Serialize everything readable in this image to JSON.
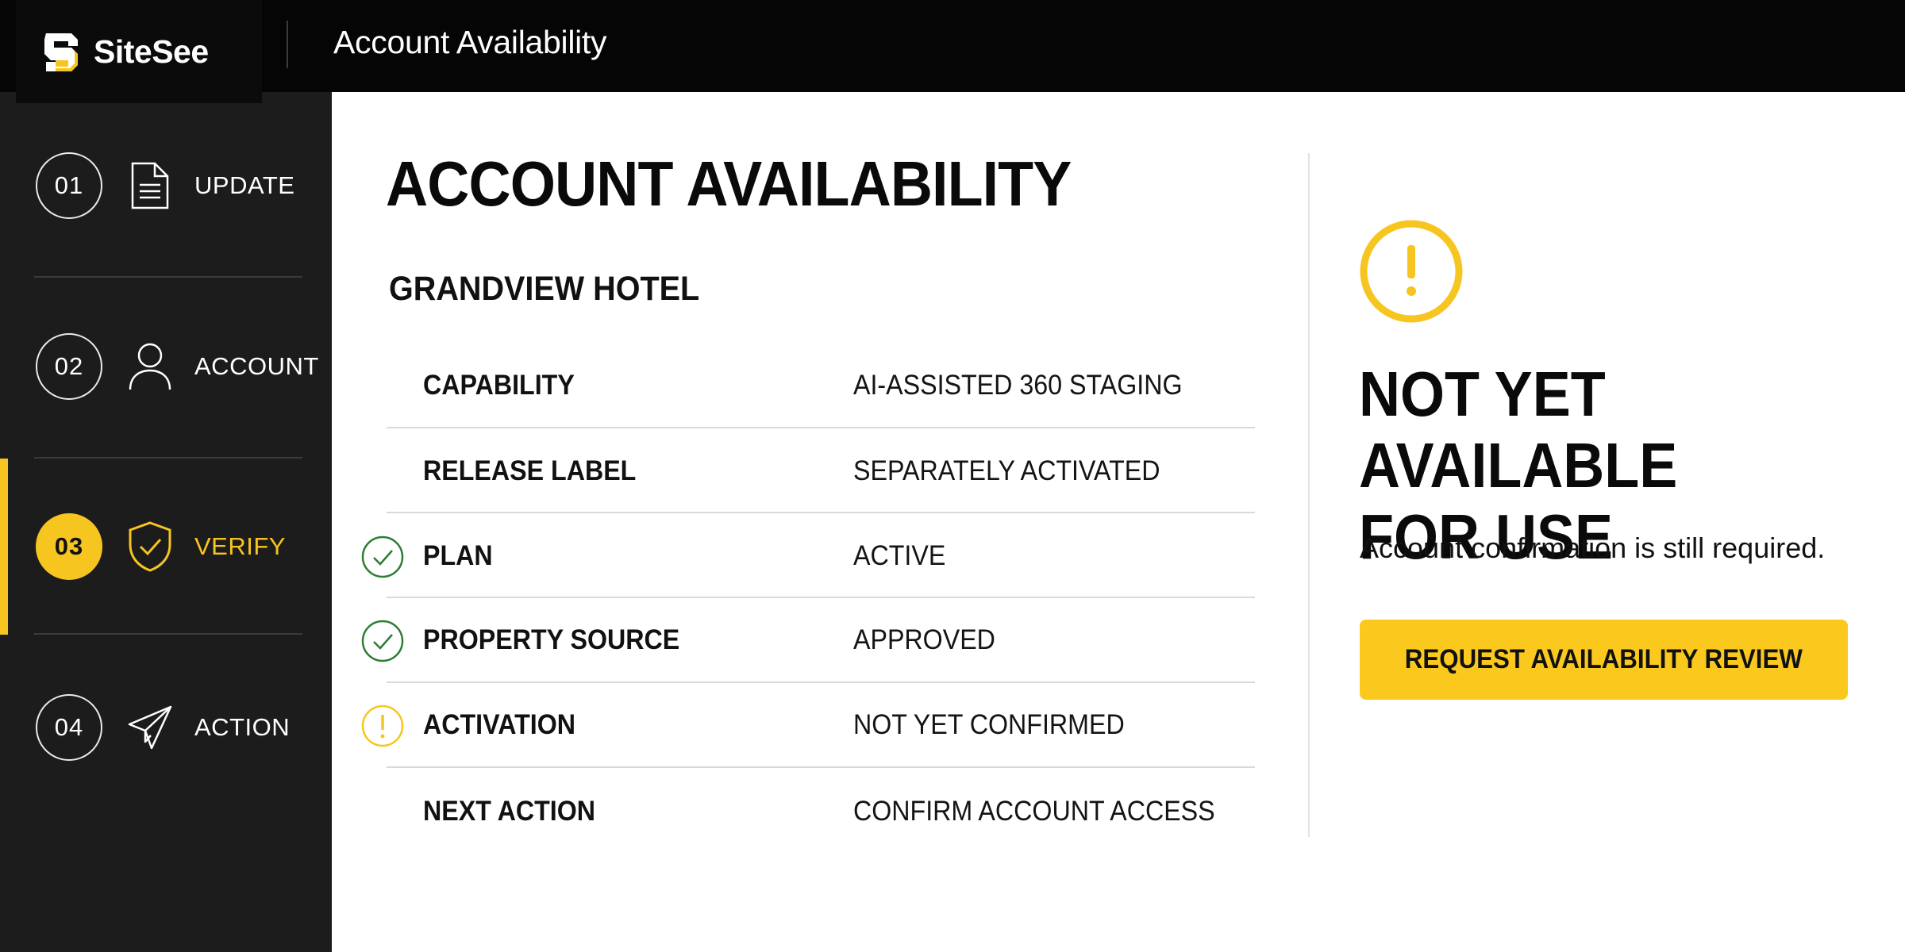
{
  "app": {
    "brand_name": "SiteSee",
    "window_title": "Account Availability"
  },
  "colors": {
    "accent": "#f7c520",
    "sidebar_bg": "#1c1c1c",
    "topbar_bg": "#050505",
    "check_green": "#2e7d32"
  },
  "sidebar": {
    "steps": [
      {
        "number": "01",
        "label": "UPDATE",
        "icon": "document-icon",
        "active": false
      },
      {
        "number": "02",
        "label": "ACCOUNT",
        "icon": "user-icon",
        "active": false
      },
      {
        "number": "03",
        "label": "VERIFY",
        "icon": "shield-check-icon",
        "active": true
      },
      {
        "number": "04",
        "label": "ACTION",
        "icon": "paper-plane-icon",
        "active": false
      }
    ]
  },
  "main": {
    "title": "ACCOUNT AVAILABILITY",
    "property_name": "GRANDVIEW HOTEL",
    "rows": [
      {
        "label": "CAPABILITY",
        "value": "AI-ASSISTED 360 STAGING",
        "status": "none"
      },
      {
        "label": "RELEASE LABEL",
        "value": "SEPARATELY ACTIVATED",
        "status": "none"
      },
      {
        "label": "PLAN",
        "value": "ACTIVE",
        "status": "check"
      },
      {
        "label": "PROPERTY SOURCE",
        "value": "APPROVED",
        "status": "check"
      },
      {
        "label": "ACTIVATION",
        "value": "NOT YET CONFIRMED",
        "status": "warning"
      },
      {
        "label": "NEXT ACTION",
        "value": "CONFIRM ACCOUNT ACCESS",
        "status": "none"
      }
    ]
  },
  "status_panel": {
    "icon": "warning-icon",
    "heading_line1": "NOT YET AVAILABLE",
    "heading_line2": "FOR USE",
    "message": "Account confirmation is still required.",
    "cta_label": "REQUEST AVAILABILITY REVIEW"
  }
}
